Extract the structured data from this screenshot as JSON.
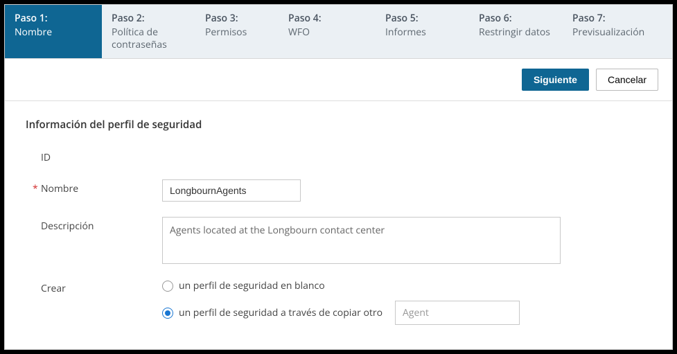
{
  "steps": [
    {
      "title": "Paso 1:",
      "sub": "Nombre",
      "active": true
    },
    {
      "title": "Paso 2:",
      "sub": "Política de contraseñas",
      "active": false
    },
    {
      "title": "Paso 3:",
      "sub": "Permisos",
      "active": false
    },
    {
      "title": "Paso 4:",
      "sub": "WFO",
      "active": false
    },
    {
      "title": "Paso 5:",
      "sub": "Informes",
      "active": false
    },
    {
      "title": "Paso 6:",
      "sub": "Restringir datos",
      "active": false
    },
    {
      "title": "Paso 7:",
      "sub": "Previsualización",
      "active": false
    }
  ],
  "actions": {
    "next": "Siguiente",
    "cancel": "Cancelar"
  },
  "section": {
    "title": "Información del perfil de seguridad",
    "id_label": "ID",
    "name_label": "Nombre",
    "name_value": "LongbournAgents",
    "desc_label": "Descripción",
    "desc_value": "Agents located at the Longbourn contact center",
    "create_label": "Crear",
    "radio_blank": "un perfil de seguridad en blanco",
    "radio_copy": "un perfil de seguridad a través de copiar otro",
    "copy_select": "Agent"
  }
}
